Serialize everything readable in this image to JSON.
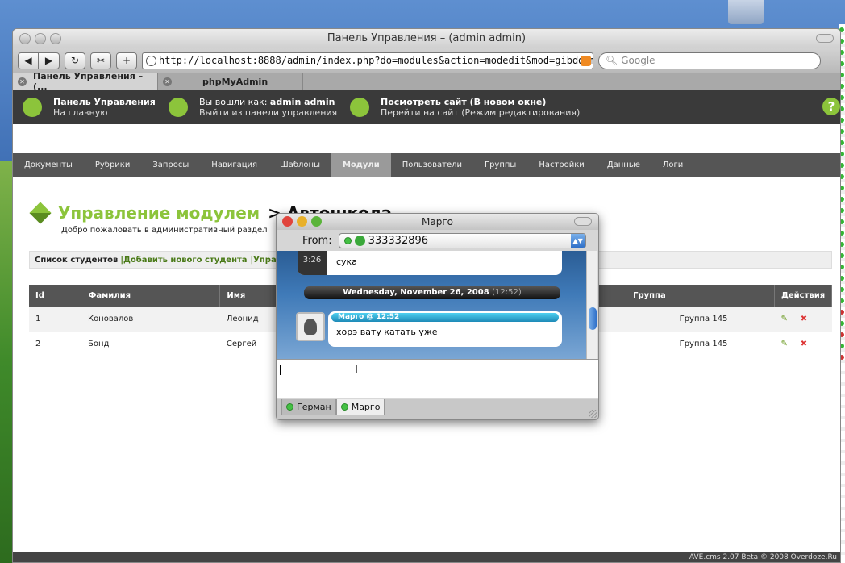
{
  "browser": {
    "title": "Панель Управления – (admin admin)",
    "url": "http://localhost:8888/admin/index.php?do=modules&action=modedit&mod=gibdd&moc",
    "search_placeholder": "Google",
    "tabs": [
      {
        "label": "Панель Управления – (..."
      },
      {
        "label": "phpMyAdmin"
      }
    ]
  },
  "header": {
    "panel_title": "Панель Управления",
    "panel_sub": "На главную",
    "login_prefix": "Вы вошли как:",
    "login_user": "admin admin",
    "logout": "Выйти из панели управления",
    "view_site": "Посмотреть сайт (В новом окне)",
    "edit_mode": "Перейти на сайт (Режим редактирования)",
    "help": "?"
  },
  "menu": [
    "Документы",
    "Рубрики",
    "Запросы",
    "Навигация",
    "Шаблоны",
    "Модули",
    "Пользователи",
    "Группы",
    "Настройки",
    "Данные",
    "Логи"
  ],
  "page": {
    "title_green": "Управление модулем",
    "title_black": "> Автошкола",
    "welcome": "Добро пожаловать в административный раздел",
    "subnav_list": "Список студентов",
    "subnav_add": "|Добавить нового студента",
    "subnav_more": "|Упра"
  },
  "table": {
    "headers": [
      "Id",
      "Фамилия",
      "Имя",
      "",
      "Группа",
      "Действия"
    ],
    "rows": [
      {
        "id": "1",
        "last": "Коновалов",
        "first": "Леонид",
        "group": "Группа 145"
      },
      {
        "id": "2",
        "last": "Бонд",
        "first": "Сергей",
        "group": "Группа 145"
      }
    ]
  },
  "status": "AVE.cms 2.07 Beta © 2008 Overdoze.Ru",
  "chat": {
    "title": "Марго",
    "from_label": "From:",
    "from_value": "333332896",
    "msg1_time": "3:26",
    "msg1_text": "сука",
    "date_main": "Wednesday, November 26, 2008",
    "date_time": "(12:52)",
    "msg2_header": "Марго @ 12:52",
    "msg2_text": "хорэ вату катать уже",
    "tabs": [
      "Герман",
      "Марго"
    ]
  }
}
